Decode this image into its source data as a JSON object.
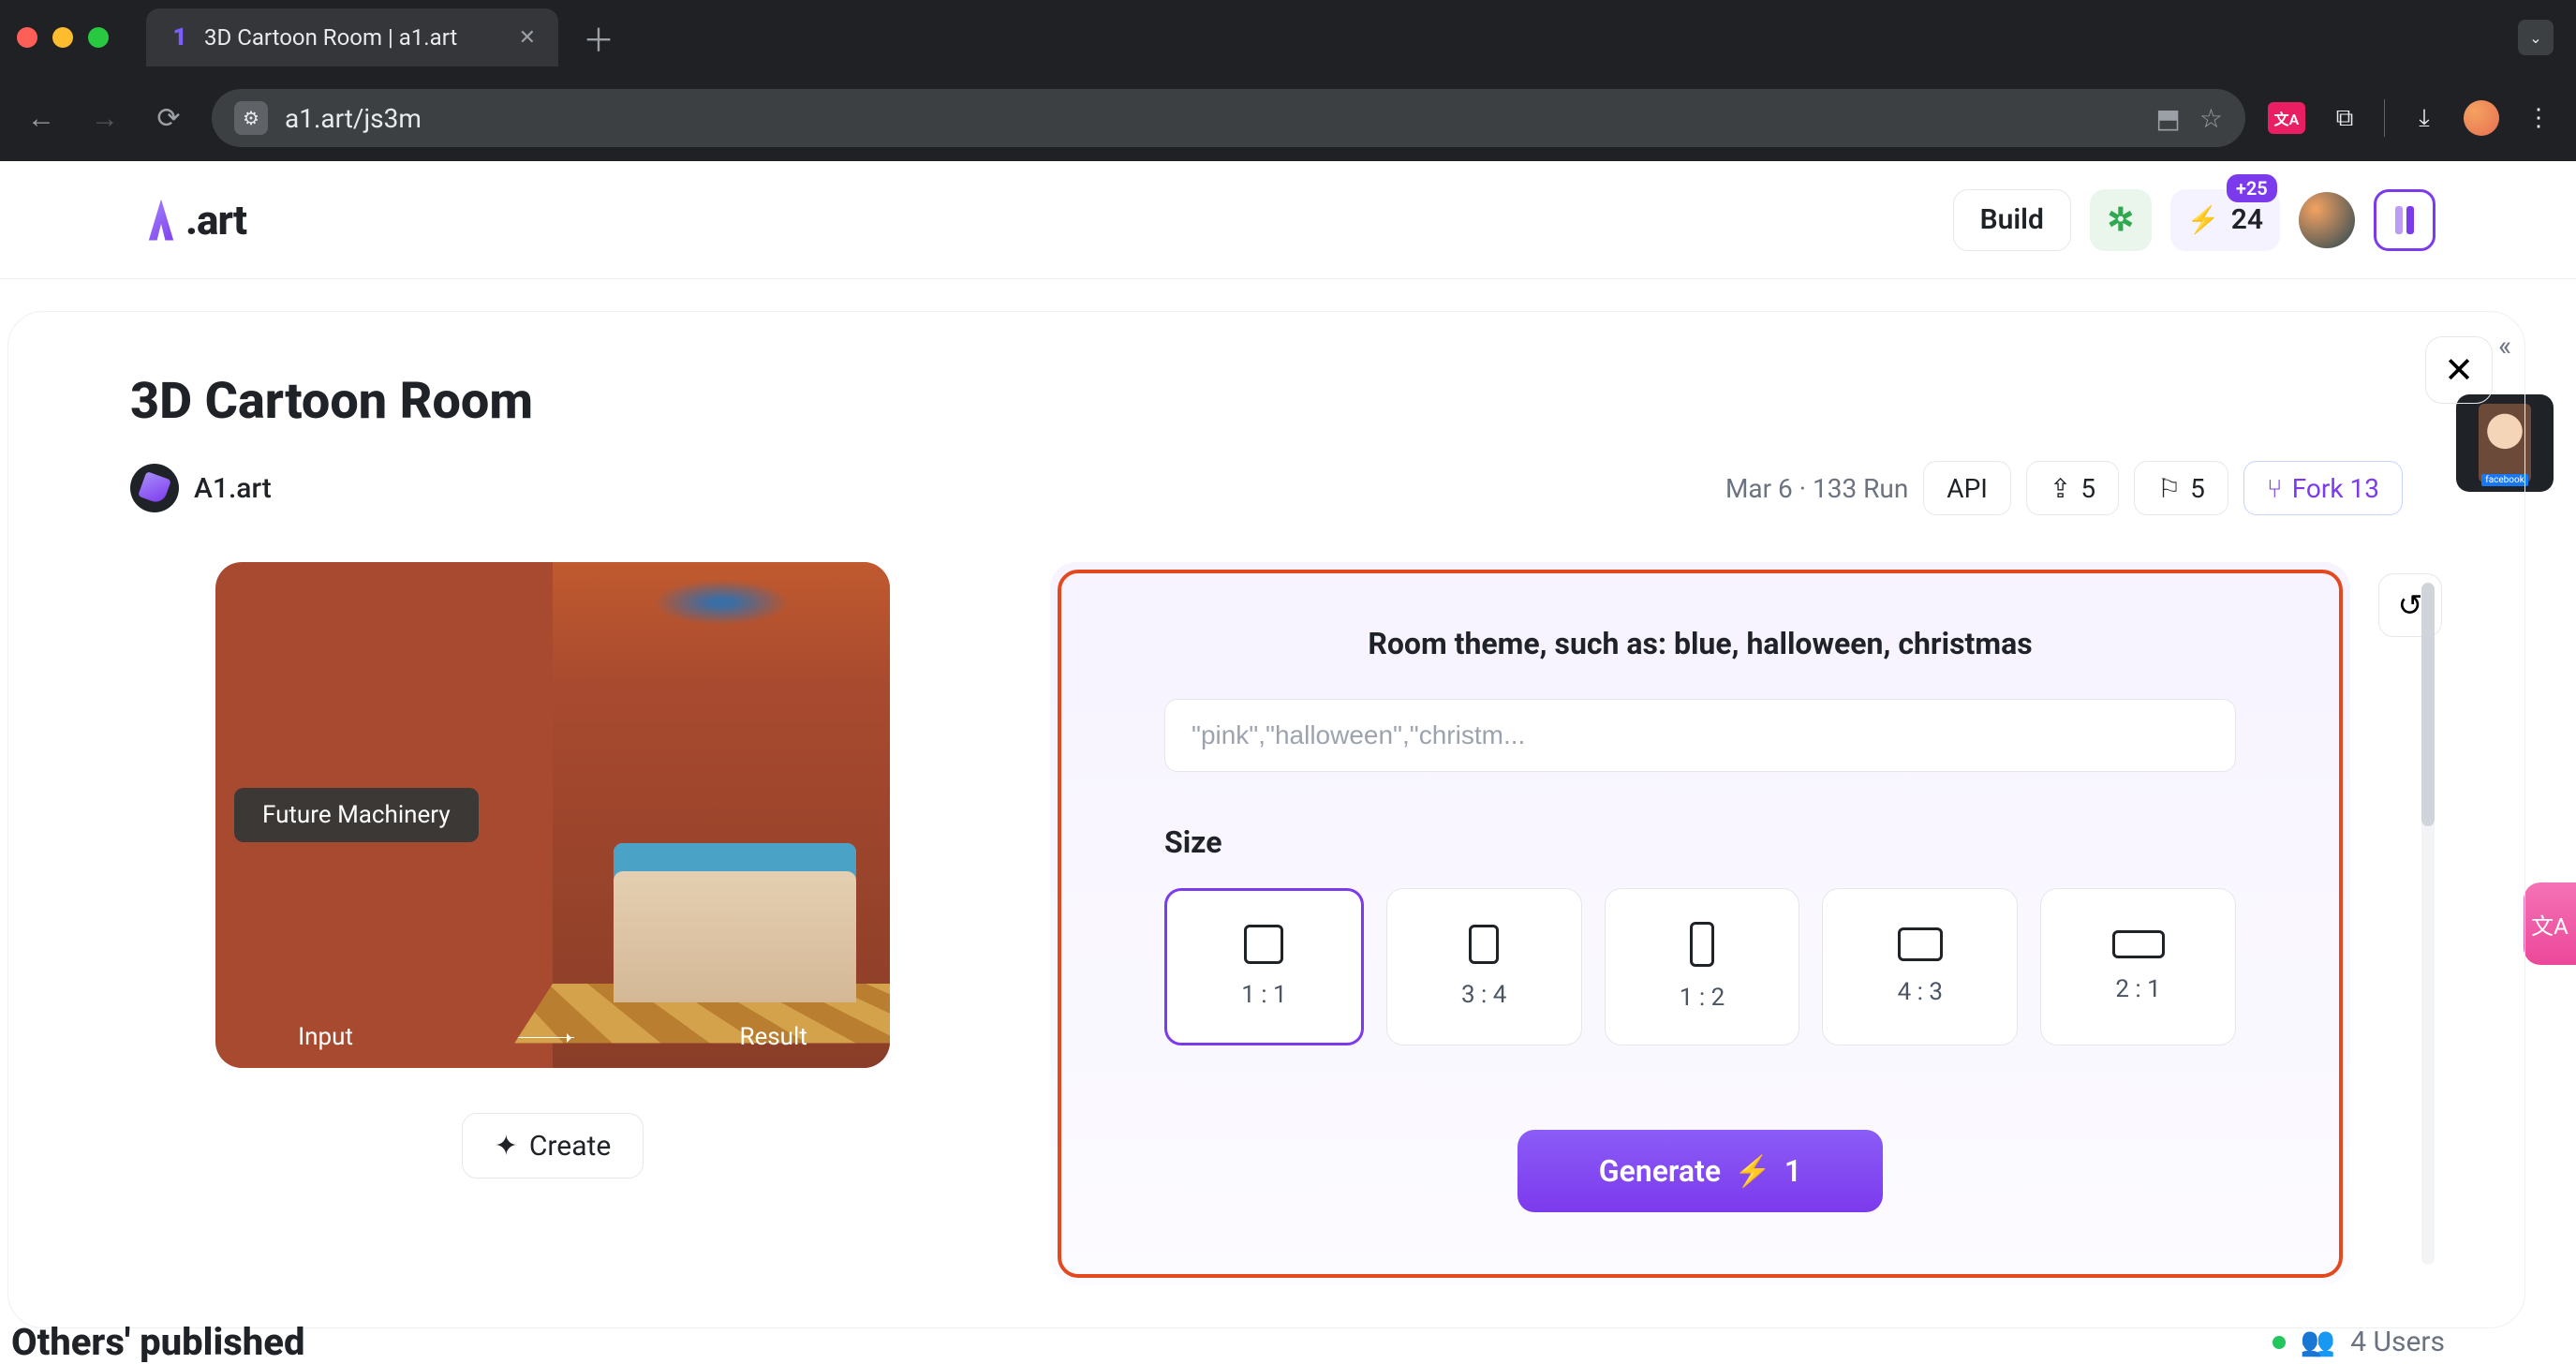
{
  "browser": {
    "tab_title": "3D Cartoon Room | a1.art",
    "url": "a1.art/js3m"
  },
  "topbar": {
    "logo_text": ".art",
    "build_label": "Build",
    "credits_badge": "+25",
    "credits_count": "24"
  },
  "page": {
    "title": "3D Cartoon Room",
    "author": "A1.art",
    "date_runs": "Mar 6 · 133 Run",
    "api_label": "API",
    "share_count": "5",
    "bookmark_count": "5",
    "fork_label": "Fork 13"
  },
  "preview": {
    "prompt_chip": "Future Machinery",
    "input_label": "Input",
    "result_label": "Result",
    "create_label": "Create"
  },
  "form": {
    "theme_label": "Room theme, such as: blue, halloween, christmas",
    "theme_placeholder": "\"pink\",\"halloween\",\"christm...",
    "size_label": "Size",
    "sizes": [
      {
        "label": "1 : 1",
        "selected": true
      },
      {
        "label": "3 : 4",
        "selected": false
      },
      {
        "label": "1 : 2",
        "selected": false
      },
      {
        "label": "4 : 3",
        "selected": false
      },
      {
        "label": "2 : 1",
        "selected": false
      }
    ],
    "generate_label": "Generate",
    "generate_cost": "1"
  },
  "others": {
    "title": "Others' published",
    "users_label": "4 Users"
  }
}
